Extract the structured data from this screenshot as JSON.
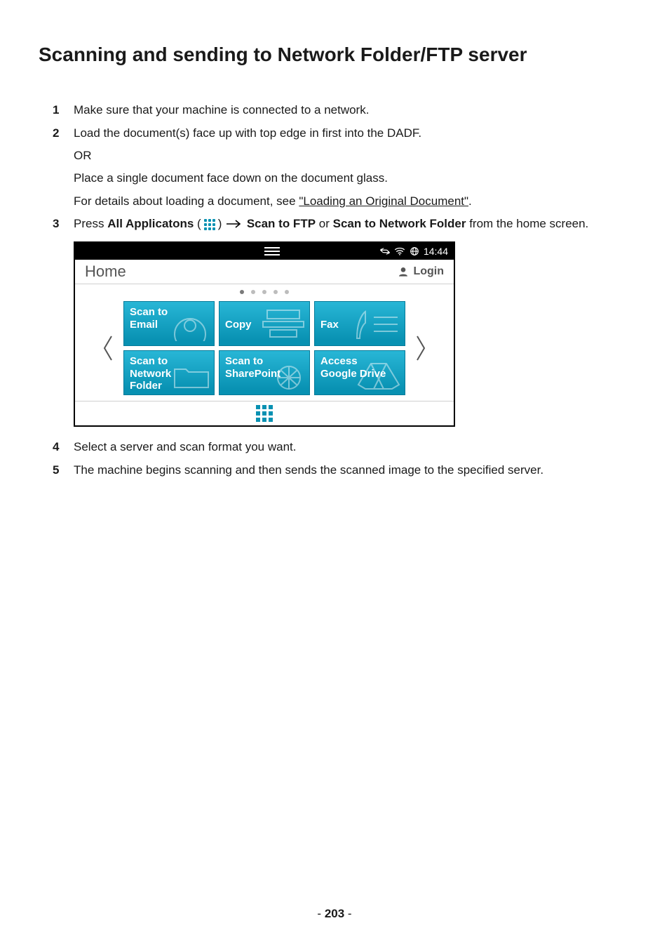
{
  "heading": "Scanning and sending to Network Folder/FTP server",
  "steps": {
    "s1": {
      "num": "1",
      "text": "Make sure that your machine is connected to a network."
    },
    "s2": {
      "num": "2",
      "line1": "Load the document(s) face up with top edge in first into the DADF.",
      "or": "OR",
      "line2": "Place a single document face down on the document glass.",
      "line3_pre": "For details about loading a document, see ",
      "line3_link": "\"Loading an Original Document\"",
      "line3_post": "."
    },
    "s3": {
      "num": "3",
      "press": "Press ",
      "all_apps": "All Applicatons",
      "paren_open": " (",
      "paren_close": ") ",
      "scan_ftp": "Scan to FTP",
      "or": " or ",
      "scan_nf": "Scan to Network Folder",
      "tail": " from the home screen."
    },
    "s4": {
      "num": "4",
      "text": "Select a server and scan format you want."
    },
    "s5": {
      "num": "5",
      "text": "The machine begins scanning and then sends the scanned image to the specified server."
    }
  },
  "device": {
    "time": "14:44",
    "home_title": "Home",
    "login": "Login",
    "tiles": {
      "t1": "Scan to\nEmail",
      "t2": "Copy",
      "t3": "Fax",
      "t4": "Scan to\nNetwork\nFolder",
      "t5": "Scan to\nSharePoint",
      "t6": "Access\nGoogle Drive"
    }
  },
  "page_number": "203"
}
